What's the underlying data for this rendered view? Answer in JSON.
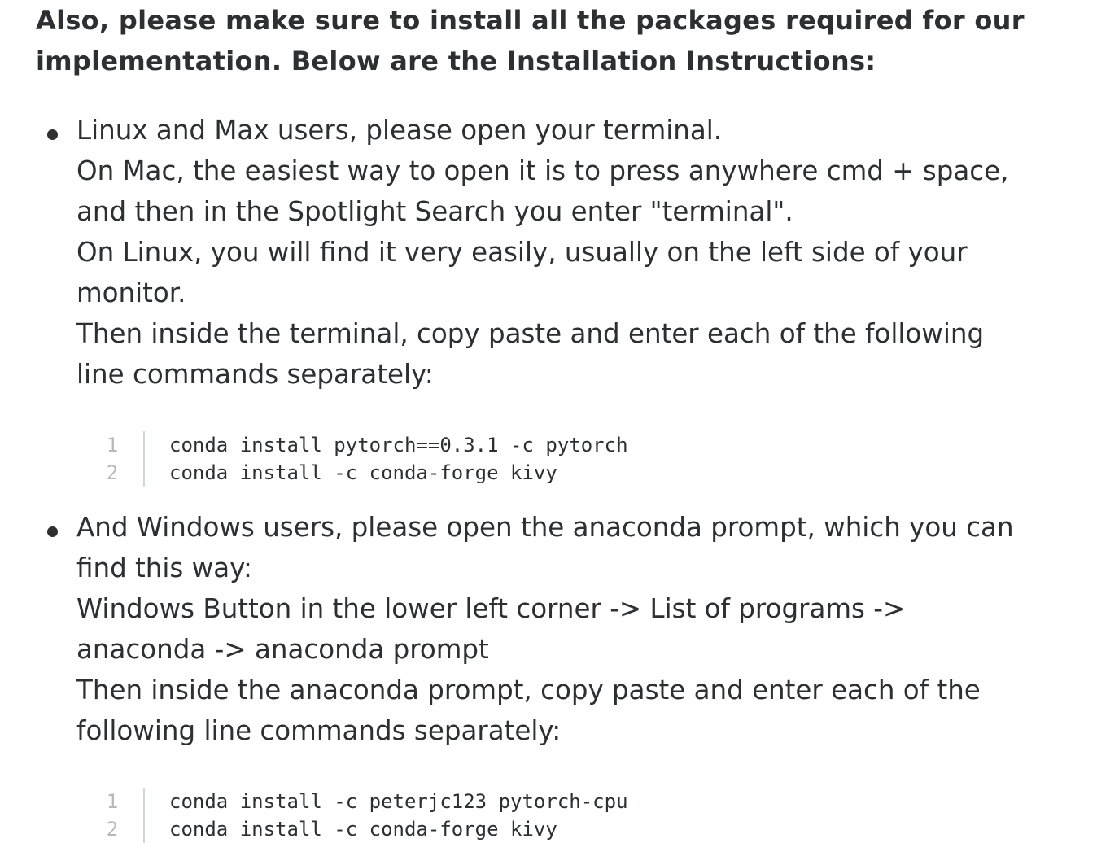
{
  "heading": {
    "line1": "Also, please make sure to install all the packages required for our",
    "line2": "implementation. Below are the Installation Instructions:"
  },
  "sections": [
    {
      "lines": [
        "Linux and Max users, please open your terminal.",
        "On Mac, the easiest way to open it is to press anywhere cmd + space,",
        "and then in the Spotlight Search you enter \"terminal\".",
        "On Linux, you will find it very easily, usually on the left side of your",
        "monitor.",
        "Then inside the terminal, copy paste and enter each of the following",
        "line commands separately:"
      ],
      "code": [
        {
          "number": "1",
          "text": "conda install pytorch==0.3.1 -c pytorch"
        },
        {
          "number": "2",
          "text": "conda install -c conda-forge kivy"
        }
      ]
    },
    {
      "lines": [
        "And Windows users, please open the anaconda prompt, which you can",
        "find this way:",
        "Windows Button in the lower left corner -> List of programs ->",
        "anaconda -> anaconda prompt",
        "Then inside the anaconda prompt, copy paste and enter each of the",
        "following line commands separately:"
      ],
      "code": [
        {
          "number": "1",
          "text": "conda install -c peterjc123 pytorch-cpu"
        },
        {
          "number": "2",
          "text": "conda install -c conda-forge kivy"
        }
      ]
    }
  ]
}
